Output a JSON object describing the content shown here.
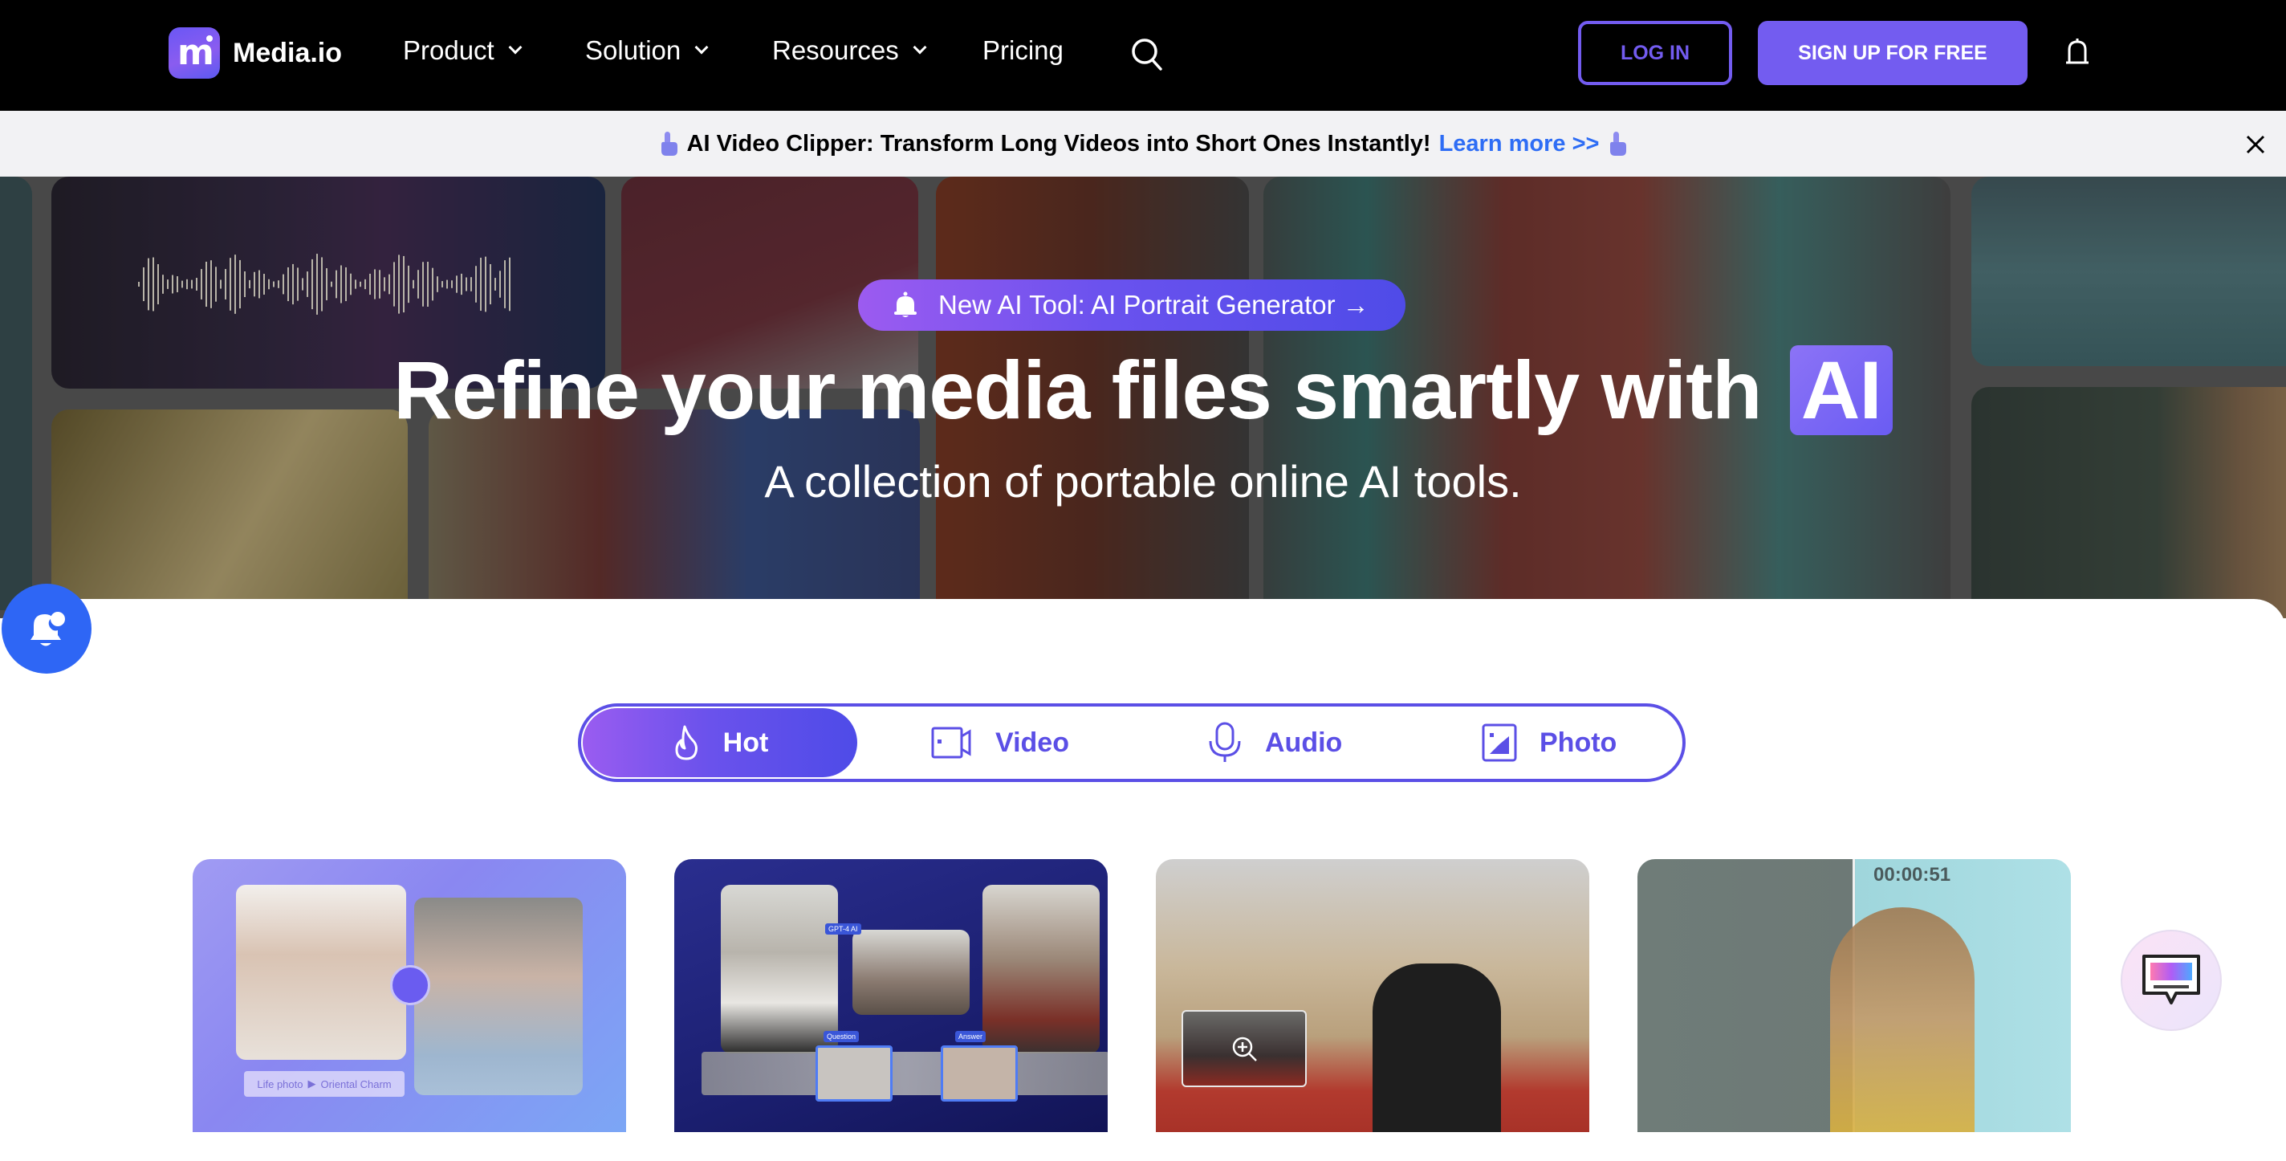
{
  "nav": {
    "brand": "Media.io",
    "items": [
      {
        "label": "Product",
        "has_dropdown": true
      },
      {
        "label": "Solution",
        "has_dropdown": true
      },
      {
        "label": "Resources",
        "has_dropdown": true
      },
      {
        "label": "Pricing",
        "has_dropdown": false
      }
    ],
    "search_icon": "search-icon",
    "login_label": "LOG IN",
    "signup_label": "SIGN UP FOR FREE",
    "notification_icon": "bell-icon"
  },
  "announcement": {
    "icon": "pointing-hand-icon",
    "text": "AI Video Clipper: Transform Long Videos into Short Ones Instantly!",
    "link_label": "Learn more >>",
    "close_icon": "close-icon"
  },
  "hero": {
    "badge_label": "New AI Tool: AI Portrait Generator →",
    "badge_icon": "bell-icon",
    "headline": "Refine your media files smartly with",
    "headline_highlight": "AI",
    "subheadline": "A collection of portable online AI tools."
  },
  "tabs": [
    {
      "label": "Hot",
      "icon": "flame-icon",
      "active": true
    },
    {
      "label": "Video",
      "icon": "video-camera-icon",
      "active": false
    },
    {
      "label": "Audio",
      "icon": "microphone-icon",
      "active": false
    },
    {
      "label": "Photo",
      "icon": "image-icon",
      "active": false
    }
  ],
  "cards": [
    {
      "name": "ai-portrait-card",
      "caption_left": "Life photo",
      "caption_right": "Oriental Charm"
    },
    {
      "name": "podcast-video-card",
      "tags": [
        "GPT-4 AI",
        "Question",
        "Answer"
      ]
    },
    {
      "name": "photo-enhance-card"
    },
    {
      "name": "video-enhance-card",
      "timestamp": "00:00:51"
    }
  ],
  "colors": {
    "brand": "#735cf0",
    "link": "#2e6df5",
    "float_button": "#2e66f5",
    "tab_border": "#5b4fe6"
  }
}
